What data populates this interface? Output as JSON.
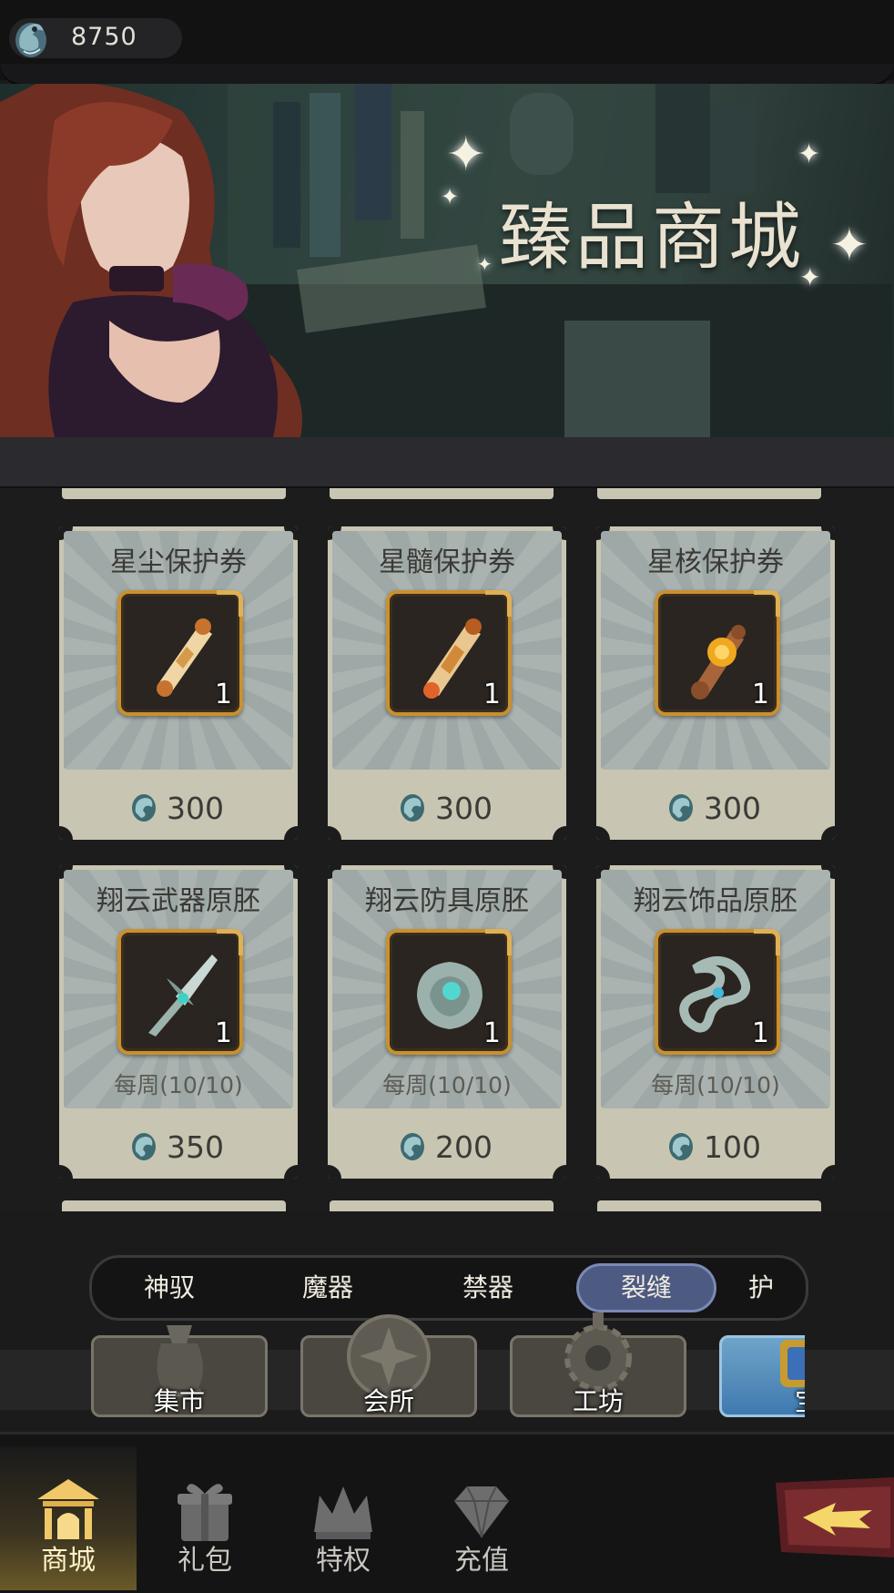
{
  "currency": {
    "icon": "dragon-coin-icon",
    "amount": "8750"
  },
  "banner": {
    "title": "臻品商城"
  },
  "items": [
    {
      "name": "星尘保护券",
      "qty": "1",
      "icon": "scroll-icon",
      "weekly": "",
      "price": "300"
    },
    {
      "name": "星髓保护券",
      "qty": "1",
      "icon": "scroll-gem-icon",
      "weekly": "",
      "price": "300"
    },
    {
      "name": "星核保护券",
      "qty": "1",
      "icon": "amber-scroll-icon",
      "weekly": "",
      "price": "300"
    },
    {
      "name": "翔云武器原胚",
      "qty": "1",
      "icon": "sword-icon",
      "weekly": "每周(10/10)",
      "price": "350"
    },
    {
      "name": "翔云防具原胚",
      "qty": "1",
      "icon": "armor-stone-icon",
      "weekly": "每周(10/10)",
      "price": "200"
    },
    {
      "name": "翔云饰品原胚",
      "qty": "1",
      "icon": "ring-ornament-icon",
      "weekly": "每周(10/10)",
      "price": "100"
    }
  ],
  "tabs": [
    "神驭",
    "魔器",
    "禁器",
    "裂缝",
    "护"
  ],
  "active_tab": "裂缝",
  "categories": [
    "集市",
    "会所",
    "工坊",
    "宝"
  ],
  "nav": [
    "商城",
    "礼包",
    "特权",
    "充值"
  ],
  "active_nav": "商城",
  "colors": {
    "accent_gold": "#c9902f",
    "tab_active": "#4d5a82",
    "card_bg": "#c8c6b2"
  }
}
